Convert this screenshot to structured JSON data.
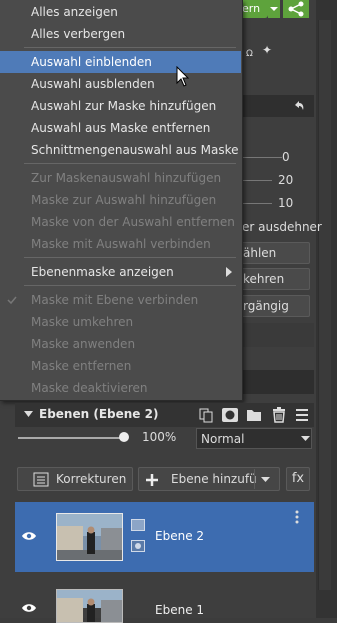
{
  "background": {
    "top_button_label": "ern",
    "values": [
      "0",
      "20",
      "10"
    ],
    "ausdehnen_label": "er ausdehner",
    "btn1": "ählen",
    "btn2": "kehren",
    "btn3": "rgängig"
  },
  "menu": {
    "items": [
      {
        "label": "Alles anzeigen",
        "state": "enabled"
      },
      {
        "label": "Alles verbergen",
        "state": "enabled"
      },
      {
        "label": "Auswahl einblenden",
        "state": "highlighted"
      },
      {
        "label": "Auswahl ausblenden",
        "state": "enabled"
      },
      {
        "label": "Auswahl zur Maske hinzufügen",
        "state": "enabled"
      },
      {
        "label": "Auswahl aus Maske entfernen",
        "state": "enabled"
      },
      {
        "label": "Schnittmengenauswahl aus Maske",
        "state": "enabled"
      },
      {
        "label": "Zur Maskenauswahl hinzufügen",
        "state": "disabled"
      },
      {
        "label": "Maske zur Auswahl hinzufügen",
        "state": "disabled"
      },
      {
        "label": "Maske von der Auswahl entfernen",
        "state": "disabled"
      },
      {
        "label": "Maske mit Auswahl verbinden",
        "state": "disabled"
      },
      {
        "label": "Ebenenmaske anzeigen",
        "state": "enabled"
      },
      {
        "label": "Maske mit Ebene verbinden",
        "state": "disabled"
      },
      {
        "label": "Maske umkehren",
        "state": "disabled"
      },
      {
        "label": "Maske anwenden",
        "state": "disabled"
      },
      {
        "label": "Maske entfernen",
        "state": "disabled"
      },
      {
        "label": "Maske deaktivieren",
        "state": "disabled"
      }
    ]
  },
  "layers": {
    "title": "Ebenen (Ebene 2)",
    "opacity": "100%",
    "blend_mode": "Normal",
    "korrekturen": "Korrekturen",
    "add_layer": "Ebene hinzufü",
    "fx": "fx",
    "rows": [
      {
        "name": "Ebene 2",
        "selected": true
      },
      {
        "name": "Ebene 1",
        "selected": false
      }
    ]
  },
  "colors": {
    "accent": "#4f7bb8",
    "green": "#5ea33c",
    "selected_row": "#3d6cb0"
  }
}
